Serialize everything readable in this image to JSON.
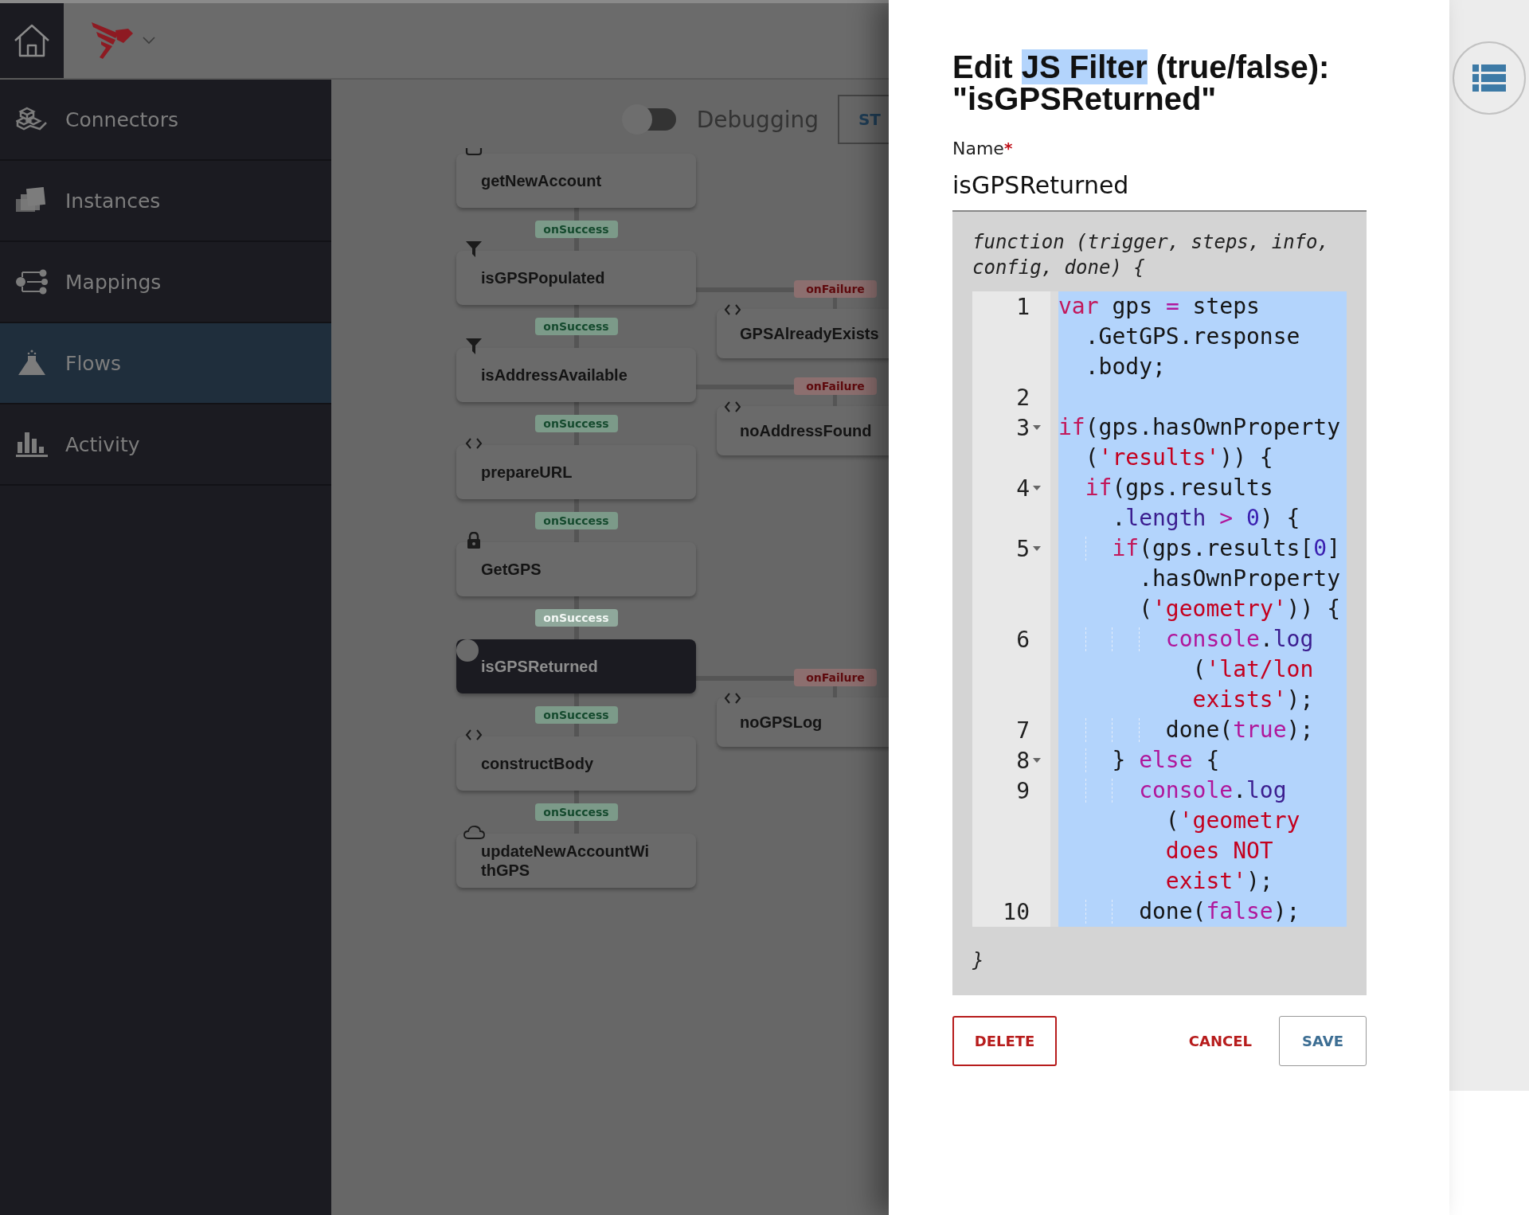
{
  "sidebar": {
    "items": [
      {
        "label": "Connectors",
        "kind": "connectors",
        "selected": false
      },
      {
        "label": "Instances",
        "kind": "instances",
        "selected": false
      },
      {
        "label": "Mappings",
        "kind": "mappings",
        "selected": false
      },
      {
        "label": "Flows",
        "kind": "flows",
        "selected": true
      },
      {
        "label": "Activity",
        "kind": "activity",
        "selected": false
      }
    ]
  },
  "toolbar": {
    "debugging": {
      "label": "Debugging",
      "on": false
    },
    "button": "ST"
  },
  "flow": {
    "steps": [
      {
        "name": "getNewAccount",
        "kind": "box",
        "selected": false,
        "on_success": {
          "label": "onSuccess",
          "faded": false
        }
      },
      {
        "name": "isGPSPopulated",
        "kind": "filter",
        "selected": false,
        "on_success": {
          "label": "onSuccess",
          "faded": false
        },
        "on_failure": {
          "label": "onFailure",
          "step": {
            "name": "GPSAlreadyExists",
            "kind": "code"
          }
        }
      },
      {
        "name": "isAddressAvailable",
        "kind": "filter",
        "selected": false,
        "on_success": {
          "label": "onSuccess",
          "faded": false
        },
        "on_failure": {
          "label": "onFailure",
          "step": {
            "name": "noAddressFound",
            "kind": "code"
          }
        }
      },
      {
        "name": "prepareURL",
        "kind": "code",
        "selected": false,
        "on_success": {
          "label": "onSuccess",
          "faded": false
        }
      },
      {
        "name": "GetGPS",
        "kind": "lock",
        "selected": false,
        "on_success": {
          "label": "onSuccess",
          "faded": true
        }
      },
      {
        "name": "isGPSReturned",
        "kind": "circle",
        "selected": true,
        "on_success": {
          "label": "onSuccess",
          "faded": false
        },
        "on_failure": {
          "label": "onFailure",
          "step": {
            "name": "noGPSLog",
            "kind": "code"
          }
        }
      },
      {
        "name": "constructBody",
        "kind": "code",
        "selected": false,
        "on_success": {
          "label": "onSuccess",
          "faded": false
        }
      },
      {
        "name": "updateNewAccountWithGPS",
        "kind": "cloud",
        "selected": false
      }
    ]
  },
  "editor": {
    "title": [
      {
        "text": "Edit ",
        "selected": false
      },
      {
        "text": "JS Filter",
        "selected": true
      },
      {
        "text": " (true/false): \"isGPSReturned\"",
        "selected": false
      }
    ],
    "name_label": "Name",
    "required_mark": "*",
    "name_value": "isGPSReturned",
    "signature": "function (trigger, steps, info, config, done) {",
    "lines": [
      {
        "number": "1",
        "fold": false,
        "rows": [
          {
            "segments": [
              {
                "text": "var",
                "color": "#c2185b"
              },
              {
                "text": " gps "
              },
              {
                "text": "=",
                "color": "#b0169b"
              },
              {
                "text": " steps"
              }
            ]
          },
          {
            "segments": [
              {
                "text": "  .GetGPS.response"
              }
            ]
          },
          {
            "segments": [
              {
                "text": "  .body;"
              }
            ]
          }
        ]
      },
      {
        "number": "2",
        "fold": false
      },
      {
        "number": "3",
        "fold": true,
        "rows": [
          {
            "segments": [
              {
                "text": "if",
                "color": "#c2185b"
              },
              {
                "text": "(gps.hasOwnProperty"
              }
            ]
          },
          {
            "segments": [
              {
                "text": "  ("
              },
              {
                "text": "'results'",
                "color": "#c4001e"
              },
              {
                "text": ")) {"
              }
            ]
          }
        ]
      },
      {
        "number": "4",
        "fold": true,
        "rows": [
          {
            "segments": [
              {
                "text": "  if",
                "color": "#c2185b"
              },
              {
                "text": "(gps.results"
              }
            ]
          },
          {
            "segments": [
              {
                "text": "    ."
              },
              {
                "text": "length",
                "color": "#3b1d8f"
              },
              {
                "text": " >",
                "color": "#b0169b"
              },
              {
                "text": " 0",
                "color": "#3a1fb0"
              },
              {
                "text": ") {"
              }
            ]
          }
        ]
      },
      {
        "number": "5",
        "fold": true,
        "rows": [
          {
            "segments": [
              {
                "text": "    if",
                "color": "#c2185b"
              },
              {
                "text": "(gps.results["
              },
              {
                "text": "0",
                "color": "#3a1fb0"
              },
              {
                "text": "]"
              }
            ]
          },
          {
            "segments": [
              {
                "text": "      .hasOwnProperty"
              }
            ]
          },
          {
            "segments": [
              {
                "text": "      ("
              },
              {
                "text": "'geometry'",
                "color": "#c4001e"
              },
              {
                "text": ")) {"
              }
            ]
          }
        ]
      },
      {
        "number": "6",
        "fold": false,
        "rows": [
          {
            "segments": [
              {
                "text": "        console",
                "color": "#b0169b"
              },
              {
                "text": "."
              },
              {
                "text": "log",
                "color": "#3b1d8f"
              }
            ]
          },
          {
            "segments": [
              {
                "text": "          ("
              },
              {
                "text": "'lat/lon",
                "color": "#c4001e"
              }
            ]
          },
          {
            "segments": [
              {
                "text": "          exists'",
                "color": "#c4001e"
              },
              {
                "text": ");"
              }
            ]
          }
        ]
      },
      {
        "number": "7",
        "fold": false,
        "rows": [
          {
            "segments": [
              {
                "text": "        done("
              },
              {
                "text": "true",
                "color": "#b0169b"
              },
              {
                "text": ");"
              }
            ]
          }
        ]
      },
      {
        "number": "8",
        "fold": true,
        "rows": [
          {
            "segments": [
              {
                "text": "    } "
              },
              {
                "text": "else",
                "color": "#b0169b"
              },
              {
                "text": " {"
              }
            ]
          }
        ]
      },
      {
        "number": "9",
        "fold": false,
        "rows": [
          {
            "segments": [
              {
                "text": "      console",
                "color": "#b0169b"
              },
              {
                "text": "."
              },
              {
                "text": "log",
                "color": "#3b1d8f"
              }
            ]
          },
          {
            "segments": [
              {
                "text": "        ("
              },
              {
                "text": "'geometry",
                "color": "#c4001e"
              }
            ]
          },
          {
            "segments": [
              {
                "text": "        does NOT",
                "color": "#c4001e"
              }
            ]
          },
          {
            "segments": [
              {
                "text": "        exist'",
                "color": "#c4001e"
              },
              {
                "text": ");"
              }
            ]
          }
        ]
      },
      {
        "number": "10",
        "fold": false,
        "rows": [
          {
            "segments": [
              {
                "text": "      done("
              },
              {
                "text": "false",
                "color": "#b0169b"
              },
              {
                "text": ");"
              }
            ]
          }
        ]
      }
    ],
    "closing": "}"
  },
  "buttons": [
    {
      "label": "DELETE",
      "kind": "danger"
    },
    {
      "label": "CANCEL",
      "kind": "text"
    },
    {
      "label": "SAVE",
      "kind": "outline"
    }
  ]
}
